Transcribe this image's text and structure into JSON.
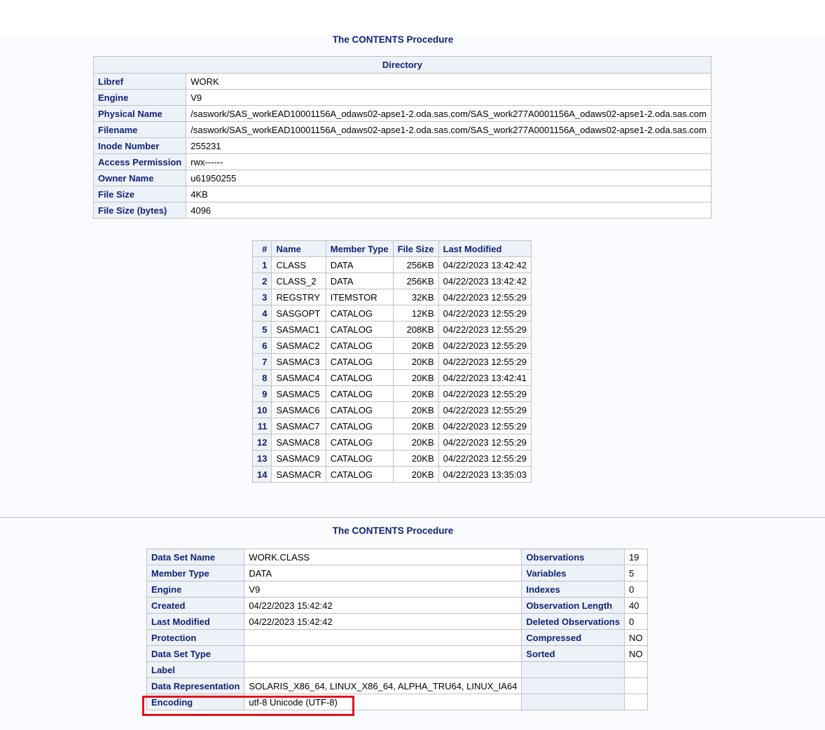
{
  "section1": {
    "title": "The CONTENTS Procedure",
    "directory": {
      "header": "Directory",
      "rows": [
        {
          "label": "Libref",
          "value": "WORK"
        },
        {
          "label": "Engine",
          "value": "V9"
        },
        {
          "label": "Physical Name",
          "value": "/saswork/SAS_workEAD10001156A_odaws02-apse1-2.oda.sas.com/SAS_work277A0001156A_odaws02-apse1-2.oda.sas.com"
        },
        {
          "label": "Filename",
          "value": "/saswork/SAS_workEAD10001156A_odaws02-apse1-2.oda.sas.com/SAS_work277A0001156A_odaws02-apse1-2.oda.sas.com"
        },
        {
          "label": "Inode Number",
          "value": "255231"
        },
        {
          "label": "Access Permission",
          "value": "rwx------"
        },
        {
          "label": "Owner Name",
          "value": "u61950255"
        },
        {
          "label": "File Size",
          "value": "4KB"
        },
        {
          "label": "File Size (bytes)",
          "value": "4096"
        }
      ]
    },
    "members": {
      "columns": [
        "#",
        "Name",
        "Member Type",
        "File Size",
        "Last Modified"
      ],
      "rows": [
        [
          "1",
          "CLASS",
          "DATA",
          "256KB",
          "04/22/2023 13:42:42"
        ],
        [
          "2",
          "CLASS_2",
          "DATA",
          "256KB",
          "04/22/2023 13:42:42"
        ],
        [
          "3",
          "REGSTRY",
          "ITEMSTOR",
          "32KB",
          "04/22/2023 12:55:29"
        ],
        [
          "4",
          "SASGOPT",
          "CATALOG",
          "12KB",
          "04/22/2023 12:55:29"
        ],
        [
          "5",
          "SASMAC1",
          "CATALOG",
          "208KB",
          "04/22/2023 12:55:29"
        ],
        [
          "6",
          "SASMAC2",
          "CATALOG",
          "20KB",
          "04/22/2023 12:55:29"
        ],
        [
          "7",
          "SASMAC3",
          "CATALOG",
          "20KB",
          "04/22/2023 12:55:29"
        ],
        [
          "8",
          "SASMAC4",
          "CATALOG",
          "20KB",
          "04/22/2023 13:42:41"
        ],
        [
          "9",
          "SASMAC5",
          "CATALOG",
          "20KB",
          "04/22/2023 12:55:29"
        ],
        [
          "10",
          "SASMAC6",
          "CATALOG",
          "20KB",
          "04/22/2023 12:55:29"
        ],
        [
          "11",
          "SASMAC7",
          "CATALOG",
          "20KB",
          "04/22/2023 12:55:29"
        ],
        [
          "12",
          "SASMAC8",
          "CATALOG",
          "20KB",
          "04/22/2023 12:55:29"
        ],
        [
          "13",
          "SASMAC9",
          "CATALOG",
          "20KB",
          "04/22/2023 12:55:29"
        ],
        [
          "14",
          "SASMACR",
          "CATALOG",
          "20KB",
          "04/22/2023 13:35:03"
        ]
      ]
    }
  },
  "section2": {
    "title": "The CONTENTS Procedure",
    "attributes": [
      {
        "l1": "Data Set Name",
        "v1": "WORK.CLASS",
        "l2": "Observations",
        "v2": "19"
      },
      {
        "l1": "Member Type",
        "v1": "DATA",
        "l2": "Variables",
        "v2": "5"
      },
      {
        "l1": "Engine",
        "v1": "V9",
        "l2": "Indexes",
        "v2": "0"
      },
      {
        "l1": "Created",
        "v1": "04/22/2023 15:42:42",
        "l2": "Observation Length",
        "v2": "40"
      },
      {
        "l1": "Last Modified",
        "v1": "04/22/2023 15:42:42",
        "l2": "Deleted Observations",
        "v2": "0"
      },
      {
        "l1": "Protection",
        "v1": "",
        "l2": "Compressed",
        "v2": "NO"
      },
      {
        "l1": "Data Set Type",
        "v1": "",
        "l2": "Sorted",
        "v2": "NO"
      },
      {
        "l1": "Label",
        "v1": "",
        "l2": "",
        "v2": ""
      },
      {
        "l1": "Data Representation",
        "v1": "SOLARIS_X86_64, LINUX_X86_64, ALPHA_TRU64, LINUX_IA64",
        "l2": "",
        "v2": ""
      },
      {
        "l1": "Encoding",
        "v1": "utf-8 Unicode (UTF-8)",
        "l2": "",
        "v2": ""
      }
    ]
  },
  "colors": {
    "header_text": "#112277",
    "header_bg": "#edf2f9",
    "border": "#c1c1c1",
    "highlight": "#e3121b"
  }
}
